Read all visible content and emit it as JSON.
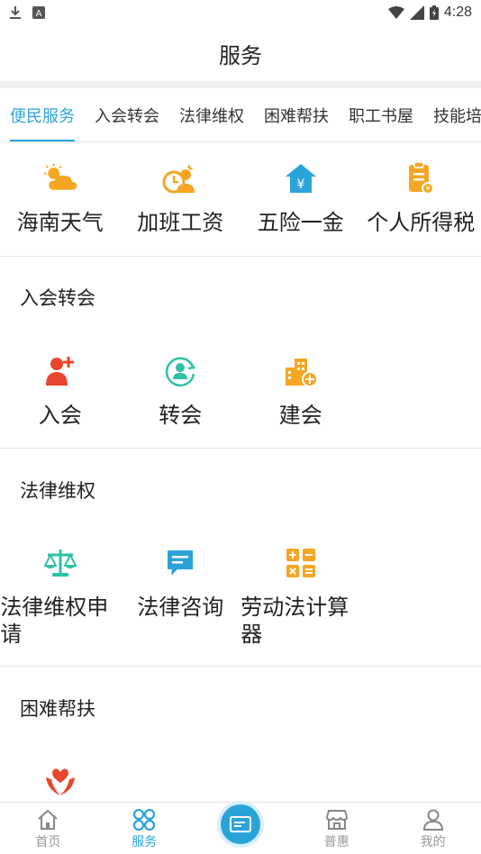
{
  "status_bar": {
    "time": "4:28"
  },
  "header": {
    "title": "服务"
  },
  "tabs": [
    {
      "label": "便民服务"
    },
    {
      "label": "入会转会"
    },
    {
      "label": "法律维权"
    },
    {
      "label": "困难帮扶"
    },
    {
      "label": "职工书屋"
    },
    {
      "label": "技能培"
    }
  ],
  "convenience": {
    "items": [
      {
        "label": "海南天气",
        "icon": "weather-icon"
      },
      {
        "label": "加班工资",
        "icon": "overtime-icon"
      },
      {
        "label": "五险一金",
        "icon": "insurance-house-icon"
      },
      {
        "label": "个人所得税",
        "icon": "tax-document-icon"
      }
    ]
  },
  "membership": {
    "title": "入会转会",
    "items": [
      {
        "label": "入会",
        "icon": "add-member-icon"
      },
      {
        "label": "转会",
        "icon": "transfer-member-icon"
      },
      {
        "label": "建会",
        "icon": "build-union-icon"
      }
    ]
  },
  "legal": {
    "title": "法律维权",
    "items": [
      {
        "label": "法律维权申请",
        "icon": "scale-icon"
      },
      {
        "label": "法律咨询",
        "icon": "chat-bubble-icon"
      },
      {
        "label": "劳动法计算器",
        "icon": "calculator-icon"
      }
    ]
  },
  "hardship": {
    "title": "困难帮扶",
    "items": [
      {
        "label": "",
        "icon": "helping-hands-heart-icon"
      }
    ]
  },
  "bottom_nav": [
    {
      "label": "首页",
      "icon": "home-icon"
    },
    {
      "label": "服务",
      "icon": "services-icon"
    },
    {
      "label": "",
      "icon": "card-icon"
    },
    {
      "label": "普惠",
      "icon": "shop-icon"
    },
    {
      "label": "我的",
      "icon": "profile-icon"
    }
  ],
  "colors": {
    "accent": "#2aa4d8",
    "orange": "#f5a623",
    "red": "#e8472f",
    "teal": "#2ec1a6"
  }
}
